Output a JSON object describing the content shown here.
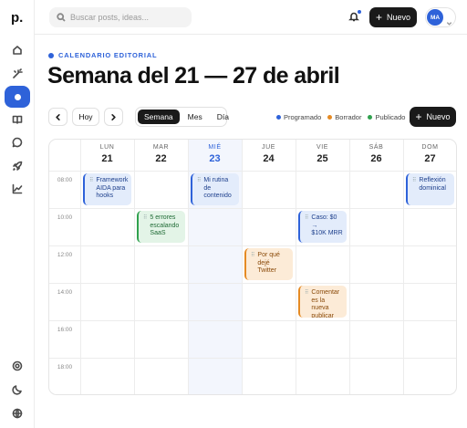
{
  "app": {
    "logo": "p."
  },
  "sidebar": {
    "items": [
      {
        "name": "home-icon"
      },
      {
        "name": "magic-wand-icon"
      },
      {
        "name": "calendar-dot-icon",
        "active": true
      },
      {
        "name": "book-icon"
      },
      {
        "name": "chat-icon"
      },
      {
        "name": "rocket-icon"
      },
      {
        "name": "analytics-icon"
      }
    ],
    "bottom_items": [
      {
        "name": "settings-icon"
      },
      {
        "name": "moon-icon"
      },
      {
        "name": "globe-icon"
      }
    ]
  },
  "topbar": {
    "search_placeholder": "Buscar posts, ideas...",
    "new_button": "Nuevo",
    "avatar_initials": "MA"
  },
  "header": {
    "eyebrow": "CALENDARIO EDITORIAL",
    "title": "Semana del 21 — 27 de abril"
  },
  "toolbar": {
    "today": "Hoy",
    "views": [
      "Semana",
      "Mes",
      "Día"
    ],
    "active_view": "Semana",
    "new_button": "Nuevo"
  },
  "legend": [
    {
      "label": "Programado",
      "color": "#2e62d9"
    },
    {
      "label": "Borrador",
      "color": "#e58a23"
    },
    {
      "label": "Publicado",
      "color": "#30a14e"
    }
  ],
  "calendar": {
    "days": [
      {
        "name": "LUN",
        "num": "21"
      },
      {
        "name": "MAR",
        "num": "22"
      },
      {
        "name": "MIÉ",
        "num": "23",
        "today": true
      },
      {
        "name": "JUE",
        "num": "24"
      },
      {
        "name": "VIE",
        "num": "25"
      },
      {
        "name": "SÁB",
        "num": "26"
      },
      {
        "name": "DOM",
        "num": "27"
      }
    ],
    "hours": [
      "08:00",
      "10:00",
      "12:00",
      "14:00",
      "16:00",
      "18:00"
    ],
    "events": [
      {
        "day": 0,
        "hour": 0,
        "lines": [
          "Framework",
          "AIDA para",
          "hooks"
        ],
        "status": "scheduled"
      },
      {
        "day": 2,
        "hour": 0,
        "lines": [
          "Mi rutina de",
          "contenido"
        ],
        "status": "scheduled"
      },
      {
        "day": 6,
        "hour": 0,
        "lines": [
          "Reflexión",
          "dominical"
        ],
        "status": "scheduled"
      },
      {
        "day": 1,
        "hour": 1,
        "lines": [
          "5 errores",
          "escalando",
          "SaaS"
        ],
        "status": "published"
      },
      {
        "day": 4,
        "hour": 1,
        "lines": [
          "Caso: $0 →",
          "$10K MRR"
        ],
        "status": "scheduled"
      },
      {
        "day": 3,
        "hour": 2,
        "lines": [
          "Por qué",
          "dejé Twitter"
        ],
        "status": "draft"
      },
      {
        "day": 4,
        "hour": 3,
        "lines": [
          "Comentar",
          "es la nueva",
          "publicar"
        ],
        "status": "draft"
      }
    ]
  }
}
